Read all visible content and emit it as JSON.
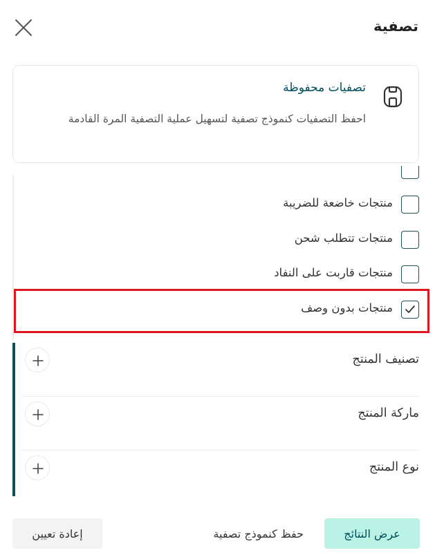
{
  "header": {
    "title": "تصفية",
    "close_icon": "close-icon"
  },
  "saved_filters": {
    "icon": "save-disk-icon",
    "title": "تصفيات محفوظة",
    "description": "احفظ التصفيات كنموذج تصفية لتسهيل عملية التصفية المرة القادمة"
  },
  "checkbox_options": [
    {
      "label": "",
      "checked": false
    },
    {
      "label": "منتجات خاضعة للضريبة",
      "checked": false
    },
    {
      "label": "منتجات تتطلب شحن",
      "checked": false
    },
    {
      "label": "منتجات قاربت على النفاد",
      "checked": false
    },
    {
      "label": "منتجات بدون وصف",
      "checked": true
    }
  ],
  "accordion": [
    {
      "label": "تصنيف المنتج",
      "icon": "plus-icon"
    },
    {
      "label": "ماركة المنتج",
      "icon": "plus-icon"
    },
    {
      "label": "نوع المنتج",
      "icon": "plus-icon"
    }
  ],
  "footer": {
    "show_results": "عرض النتائج",
    "save_template": "حفظ كنموذج تصفية",
    "reset": "إعادة تعيين"
  },
  "colors": {
    "accent": "#004d5a",
    "primary_button_bg": "#baf3e6",
    "highlight": "#e0141f"
  }
}
